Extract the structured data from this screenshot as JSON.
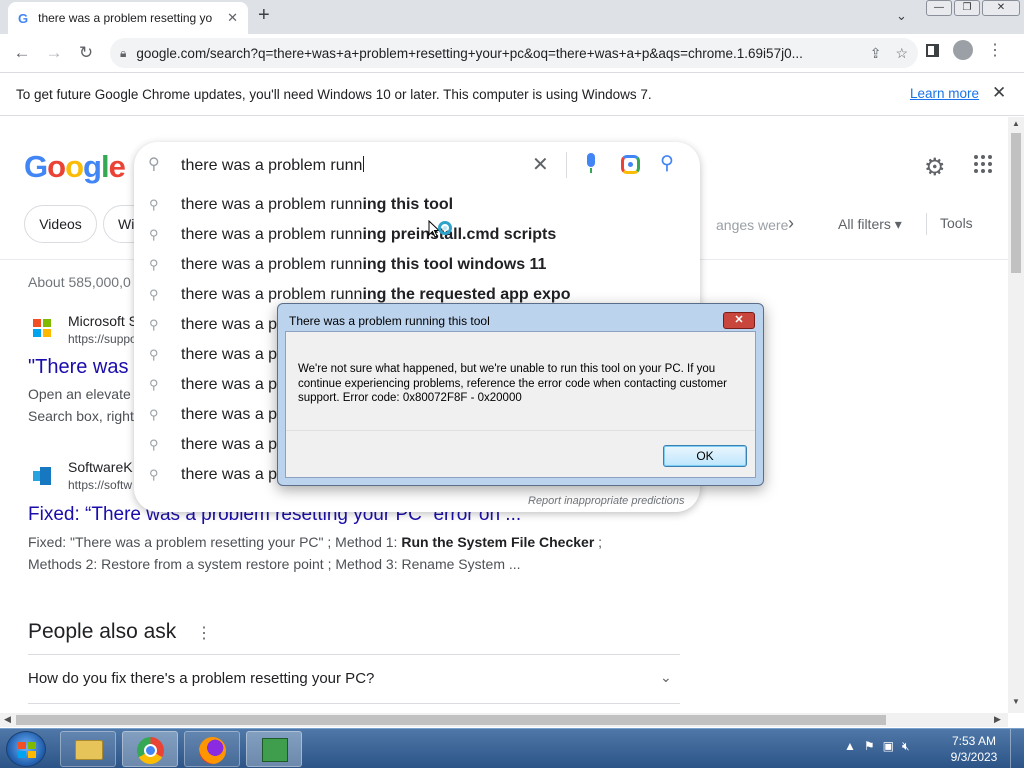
{
  "browser": {
    "tab_title": "there was a problem resetting yo",
    "tab_favicon": "G",
    "close_tab_glyph": "✕",
    "new_tab_glyph": "+",
    "tab_search_glyph": "⌄",
    "url": "google.com/search?q=there+was+a+problem+resetting+your+pc&oq=there+was+a+p&aqs=chrome.1.69i57j0...",
    "window_buttons": {
      "minimize": "—",
      "restore": "❐",
      "close": "✕"
    }
  },
  "infobar": {
    "message": "To get future Google Chrome updates, you'll need Windows 10 or later. This computer is using Windows 7.",
    "learn_more": "Learn more",
    "close": "✕"
  },
  "google": {
    "logo": [
      "G",
      "o",
      "o",
      "g",
      "l",
      "e"
    ],
    "search_query": "there was a problem runn",
    "suggestions": [
      {
        "prefix": "there was a problem runn",
        "bold": "ing this tool"
      },
      {
        "prefix": "there was a problem runn",
        "bold": "ing preinstall.cmd scripts"
      },
      {
        "prefix": "there was a problem runn",
        "bold": "ing this tool windows 11"
      },
      {
        "prefix": "there was a problem runn",
        "bold": "ing the requested app expo"
      },
      {
        "prefix": "there was a p",
        "bold": ""
      },
      {
        "prefix": "there was a p",
        "bold": ""
      },
      {
        "prefix": "there was a p",
        "bold": ""
      },
      {
        "prefix": "there was a p",
        "bold": ""
      },
      {
        "prefix": "there was a p",
        "bold": ""
      },
      {
        "prefix": "there was a p",
        "bold": ""
      }
    ],
    "report_link": "Report inappropriate predictions",
    "chips": [
      "Videos",
      "Wi"
    ],
    "chip_fade_text": "anges were",
    "all_filters": "All filters",
    "tools": "Tools",
    "result_count": "About 585,000,0",
    "results": [
      {
        "site_name": "Microsoft S",
        "site_url": "https://suppo",
        "title": "\"There was",
        "snippet_1": "Open an elevate",
        "snippet_2": "Search box, right"
      },
      {
        "site_name": "SoftwareK",
        "site_url": "https://softw",
        "title": "Fixed: “There was a problem resetting your PC” error on ...",
        "snippet_1_a": "Fixed: \"There was a problem resetting your PC\" ; Method 1: ",
        "snippet_1_bold": "Run the System File Checker",
        "snippet_1_b": " ;",
        "snippet_2": "Methods 2: Restore from a system restore point ; Method 3: Rename System ..."
      }
    ],
    "people_also_ask": {
      "heading": "People also ask",
      "question_1": "How do you fix there's a problem resetting your PC?"
    }
  },
  "dialog": {
    "title": "There was a problem running this tool",
    "close_glyph": "✕",
    "message": "We're not sure what happened, but we're unable to run this tool on your PC. If you continue experiencing problems, reference the error code when contacting customer support. Error code: 0x80072F8F - 0x20000",
    "ok_label": "OK"
  },
  "taskbar": {
    "time": "7:53 AM",
    "date": "9/3/2023"
  },
  "colors": {
    "google_blue": "#4285f4",
    "google_red": "#ea4335",
    "google_yellow": "#fbbc05",
    "google_green": "#34a853",
    "link": "#1a0dab"
  }
}
